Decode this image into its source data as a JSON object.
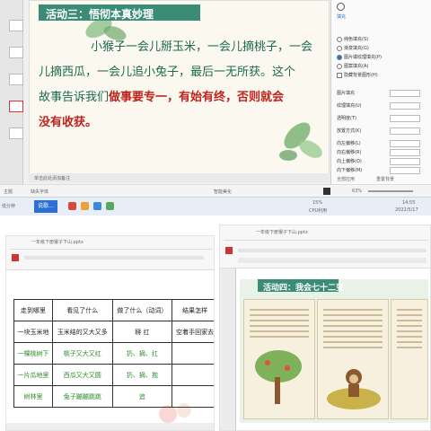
{
  "top": {
    "slide_title": "活动三：悟彻本真妙理",
    "story_lines": [
      [
        "小猴子一会儿掰玉米，一会儿摘桃子，一会"
      ],
      [
        "儿摘西瓜，一会儿追小兔子，最后一无所获。这个"
      ],
      [
        "故事告诉我们",
        "做事要专一，有始有终，否则就会"
      ],
      [
        "没有收获。"
      ]
    ],
    "panel": {
      "tab": "填充",
      "radios": [
        "纯色填充(S)",
        "渐变填充(G)",
        "图片或纹理填充(P)",
        "图案填充(A)",
        "隐藏背景图形(H)"
      ],
      "rows": [
        "图片填充",
        "纹理填充(U)",
        "透明度(T)",
        "放置方式(K)",
        "向左偏移(L)",
        "向右偏移(R)",
        "向上偏移(O)",
        "向下偏移(M)"
      ],
      "footer": [
        "全部应用",
        "重置背景"
      ]
    },
    "notes_placeholder": "单击此处添加备注",
    "status": {
      "left": "主题",
      "mid": "缺失字体",
      "smart": "智能美化",
      "zoom": "63%"
    },
    "taskbar": {
      "left": "低分辨",
      "app": "说歌…",
      "cpu": "CPU利用",
      "cpu_val": "15%",
      "time": "14:55",
      "date": "2022/5/17"
    }
  },
  "bottom_left": {
    "filename": "一年级下册猴子下山.pptx",
    "table": {
      "headers": [
        "走到哪里",
        "看见了什么",
        "做了什么（动词）",
        "结果怎样"
      ],
      "rows": [
        [
          "一块玉米地",
          "玉米结的又大又多",
          "掰  扛",
          "空着手回家去"
        ],
        [
          "一棵桃树下",
          "桃子又大又红",
          "扔、摘、扛",
          ""
        ],
        [
          "一片瓜地里",
          "西瓜又大又圆",
          "扔、摘、抱",
          ""
        ],
        [
          "树林里",
          "兔子蹦蹦跳跳",
          "追",
          ""
        ]
      ]
    }
  },
  "bottom_right": {
    "filename": "一年级下册猴子下山.pptx",
    "slide_title": "活动四：我会七十二变"
  }
}
